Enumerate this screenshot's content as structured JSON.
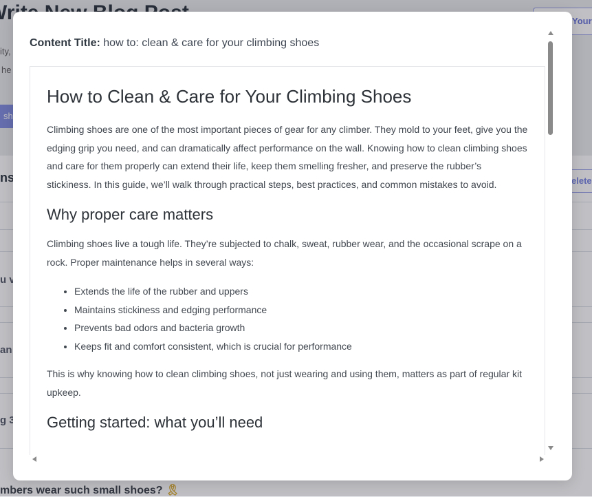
{
  "background": {
    "page_title": "Write New Blog Post",
    "desc_lines": [
      "ity,",
      "he"
    ],
    "pill_label": "sh",
    "top_button_label": "Your",
    "section_heading": "ns",
    "delete_label": "elete",
    "rows": [
      "u v",
      "an",
      "g 3"
    ],
    "bottom_question": "mbers wear such small shoes?",
    "bottom_emoji": "🎗"
  },
  "modal": {
    "content_title_label": "Content Title:",
    "content_title_value": "how to: clean & care for your climbing shoes",
    "doc": {
      "title": "How to Clean & Care for Your Climbing Shoes",
      "intro": "Climbing shoes are one of the most important pieces of gear for any climber. They mold to your feet, give you the edging grip you need, and can dramatically affect performance on the wall. Knowing how to clean climbing shoes and care for them properly can extend their life, keep them smelling fresher, and preserve the rubber’s stickiness. In this guide, we’ll walk through practical steps, best practices, and common mistakes to avoid.",
      "section1_heading": "Why proper care matters",
      "section1_para": "Climbing shoes live a tough life. They’re subjected to chalk, sweat, rubber wear, and the occasional scrape on a rock. Proper maintenance helps in several ways:",
      "section1_bullets": [
        "Extends the life of the rubber and uppers",
        "Maintains stickiness and edging performance",
        "Prevents bad odors and bacteria growth",
        "Keeps fit and comfort consistent, which is crucial for performance"
      ],
      "section1_closing": "This is why knowing how to clean climbing shoes, not just wearing and using them, matters as part of regular kit upkeep.",
      "section2_heading": "Getting started: what you’ll need"
    }
  }
}
